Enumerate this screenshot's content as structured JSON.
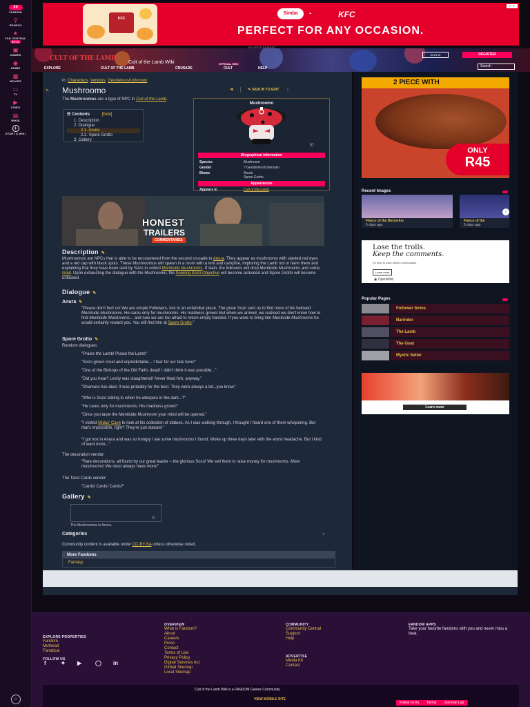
{
  "global_nav": {
    "badge": "20",
    "items": [
      {
        "label": "FANDOM",
        "icon": "fandom-icon"
      },
      {
        "label": "SEARCH",
        "icon": "search-icon"
      },
      {
        "label": "FAN CENTRAL",
        "icon": "fan-central-icon",
        "tag": "BETA"
      },
      {
        "label": "GAMES",
        "icon": "games-icon"
      },
      {
        "label": "ANIME",
        "icon": "anime-icon"
      },
      {
        "label": "MOVIES",
        "icon": "movies-icon"
      },
      {
        "label": "TV",
        "icon": "tv-icon"
      },
      {
        "label": "VIDEO",
        "icon": "video-icon"
      },
      {
        "label": "WIKIS",
        "icon": "wikis-icon"
      },
      {
        "label": "START A WIKI",
        "icon": "plus-icon"
      }
    ]
  },
  "top_ad": {
    "brand1": "Simba",
    "separator": "-",
    "brand2": "KFC",
    "slogan": "PERFECT FOR ANY OCCASION.",
    "bucket_label": "KFC",
    "label": "ADVERTISEMENT",
    "colors": {
      "bg": "#e4002b"
    }
  },
  "wiki_header": {
    "logo": "CULT OF THE LAMB",
    "title": "Cult of the Lamb Wiki",
    "badge": "OFFICIAL WIKI",
    "tabs": [
      "EXPLORE",
      "CULT OF THE LAMB",
      "CRUSADE",
      "CULT",
      "HELP"
    ],
    "sign_in": "SIGN IN",
    "register": "REGISTER",
    "search_placeholder": "Search"
  },
  "article": {
    "breadcrumb_prefix": "in:",
    "breadcrumbs": [
      "Characters",
      "Vendors",
      "Genderless/Unknown"
    ],
    "title": "Mushroomo",
    "actions": {
      "sign_in_to_edit": "SIGN IN TO EDIT"
    },
    "intro": {
      "pre": "The ",
      "bold": "Mushroomos",
      "mid": " are a type of NPC in ",
      "link": "Cult of the Lamb",
      "post": "."
    },
    "toc": {
      "title": "Contents",
      "hide": "[hide]",
      "items": [
        {
          "num": "1.",
          "label": "Description"
        },
        {
          "num": "2.",
          "label": "Dialogue"
        },
        {
          "num": "2.1.",
          "label": "Anura",
          "sub": true
        },
        {
          "num": "2.2.",
          "label": "Spore Grotto",
          "sub": true
        },
        {
          "num": "3.",
          "label": "Gallery"
        }
      ]
    },
    "infobox": {
      "title": "Mushroomo",
      "section1": "Biographical information",
      "rows": [
        {
          "k": "Species",
          "v": "Mushroom"
        },
        {
          "k": "Gender",
          "v": "? Genderless/Unknown"
        },
        {
          "k": "Biome",
          "v": "Anura"
        },
        {
          "k": "",
          "v": "Spore Grotto"
        }
      ],
      "section2": "Appearances",
      "appears_k": "Appears in",
      "appears_v": "Cult of the Lamb"
    },
    "video": {
      "line1": "HONEST",
      "line2": "TRAILERS",
      "line3": "COMMENTARIES"
    },
    "description": {
      "heading": "Description",
      "p1": "Mushroomos are NPCs that is able to be encountered from the second crusade to ",
      "l1": "Anura",
      "p2": ". They appear as mushrooms with slanted red eyes and a red cap with black spots. These Mushroomos will spawn in a room with a tent and campfire, imploring the Lamb not to harm them and explaining that they have been sent by Sozo to collect ",
      "l2": "Menticide Mushrooms",
      "p3": ". If slain, the followers will drop Menticide Mushrooms and some ",
      "l3": "Gold",
      "p4": ". Upon exhausting the dialogue with the Mushroomo, the ",
      "l4": "Seeking Sozo Objective",
      "p5": " will become activated and Spore Grotto will become unlocked."
    },
    "dialogue": {
      "heading": "Dialogue",
      "anura": {
        "heading": "Anura",
        "q1": "\"Please don't hurt us! We are simple Followers, lost in an unfamiliar place. The great ",
        "q1i": "Sozo",
        "q2": " sent us to find more of his beloved ",
        "q2i": "Menticide Mushrooms",
        "q3": ". He cares only for mushrooms. His madness grows! But when we arrived, we realised we don't know how to find ",
        "q3i": "Menticide Mushrooms",
        "q4": "... and now we are too afraid to return empty handed. If you were to bring him ",
        "q4i": "Menticide Mushrooms",
        "q5": " he would certainly reward you. You will find him at ",
        "q5l": "Spore Grotto",
        "q6": ".\""
      },
      "spore": {
        "heading": "Spore Grotto",
        "intro": "Random dialogues:",
        "lines": [
          "\"Praise the Lamb! Praise the Lamb\"",
          "\"Sozo grows cruel and unpredictable... I fear for our fate here!\"",
          "\"One of the Bishops of the Old Faith, dead! I didn't think it was possible...\"",
          "\"Did you hear? Leshy was slaughtered! Never liked him, anyway.\"",
          "\"Shamura has died. It was probably for the best. They were always a bit...you know.\"",
          "\"Who is Sozo talking to when he whispers in the dark...?\"",
          "\"He cares only for mushrooms. His madness grows!\"",
          "\"Once you taste the Menticide Mushroom your mind will be opened.\""
        ],
        "midas_pre": "\"I visited ",
        "midas_link": "Midas' Cave",
        "midas_post": " to look at his collection of statues. As I was walking through, I thought I heard one of them whispering. But that's impossible, right? They're just statues!\"",
        "lost": "\"I got lost in Anura and was so hungry I ate some mushrooms I found. Woke up three days later with the worst headache. But I kind of want more...\""
      },
      "decoration": {
        "label": "The decoration vendor:",
        "q_pre": "\"Rare decorations, all found by our great leader – the glorious Sozo! We sell them to raise money for mushrooms. ",
        "q_ital": "More mushrooms",
        "q_post": "! We must always have more!\""
      },
      "tarot": {
        "label": "The Tarot Cards vendor:",
        "q": "\"Cards! Cards! Cards?\""
      }
    },
    "gallery": {
      "heading": "Gallery",
      "caption": "The Mushroomos in Anura."
    },
    "categories": "Categories",
    "license": {
      "pre": "Community content is available under ",
      "link": "CC-BY-SA",
      "post": " unless otherwise noted."
    },
    "more_fandoms": {
      "title": "More Fandoms",
      "items": [
        "Fantasy"
      ]
    }
  },
  "rail": {
    "ad1": {
      "band": "2 PIECE WITH",
      "only": "ONLY",
      "price": "R45"
    },
    "recent_images": {
      "heading": "Recent Images",
      "items": [
        {
          "title": "Fleece of the Berserker",
          "date": "5 days ago"
        },
        {
          "title": "Fleece of the",
          "date": "5 days ago"
        }
      ]
    },
    "ad2": {
      "l1": "Lose the trolls.",
      "l2": "Keep the comments.",
      "l3": "It's time to save online conversation.",
      "btn": "Learn more",
      "brand": "OpenWeb"
    },
    "popular_pages": {
      "heading": "Popular Pages",
      "items": [
        "Follower forms",
        "Narinder",
        "The Lamb",
        "The Goat",
        "Mystic Seller"
      ]
    },
    "ad3": {
      "btn": "Learn more"
    }
  },
  "footer": {
    "explore": {
      "heading": "EXPLORE PROPERTIES",
      "links": [
        "Fandom",
        "Muthead",
        "Fanatical"
      ]
    },
    "follow": {
      "heading": "FOLLOW US"
    },
    "overview": {
      "heading": "OVERVIEW",
      "links": [
        "What is Fandom?",
        "About",
        "Careers",
        "Press",
        "Contact",
        "Terms of Use",
        "Privacy Policy",
        "Digital Services Act",
        "Global Sitemap",
        "Local Sitemap"
      ]
    },
    "community": {
      "heading": "COMMUNITY",
      "links": [
        "Community Central",
        "Support",
        "Help"
      ]
    },
    "advertise": {
      "heading": "ADVERTISE",
      "links": [
        "Media Kit",
        "Contact"
      ]
    },
    "apps": {
      "heading": "FANDOM APPS",
      "text": "Take your favorite fandoms with you and never miss a beat."
    },
    "community_note": "Cult of the Lamb Wiki is a FANDOM Games Community.",
    "mobile": "VIEW MOBILE SITE",
    "bar": [
      "Follow on IG",
      "TikTok",
      "Join Fan Lab"
    ]
  }
}
